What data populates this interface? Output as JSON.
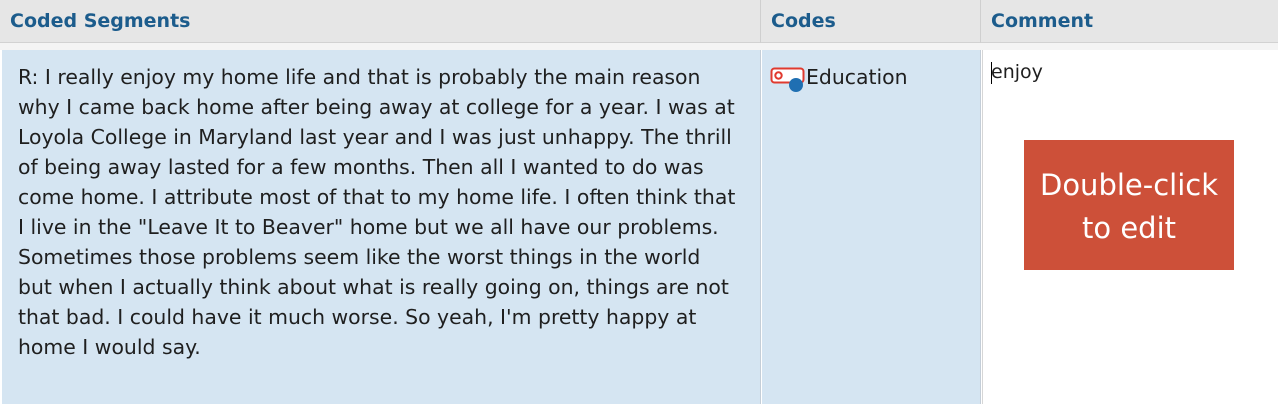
{
  "columns": {
    "segments": "Coded Segments",
    "codes": "Codes",
    "comment": "Comment"
  },
  "row": {
    "segment_text": "R: I really enjoy my home life and that is probably the main reason why I came back home after being away at college for a year. I was at Loyola College in Maryland last year and I was just unhappy. The thrill of being away lasted for a few months. Then all I wanted to do was come home. I attribute most of that to my home life. I often think that I live in the \"Leave It to Beaver\" home but we all have our problems. Sometimes those problems seem like the worst things in the world but when I actually think about what is really going on, things are not that bad. I could have it much worse. So yeah, I'm pretty happy at home I would say.",
    "code": "Education",
    "code_icon": "code-tag-icon",
    "comment_value": "enjoy"
  },
  "overlay": {
    "line1": "Double-click",
    "line2": "to edit"
  },
  "colors": {
    "header_text": "#1c5c8c",
    "row_highlight": "#d5e5f2",
    "overlay_bg": "#cd5039",
    "code_tag_red": "#e03a2f",
    "code_tag_dot": "#1f6fb2"
  }
}
